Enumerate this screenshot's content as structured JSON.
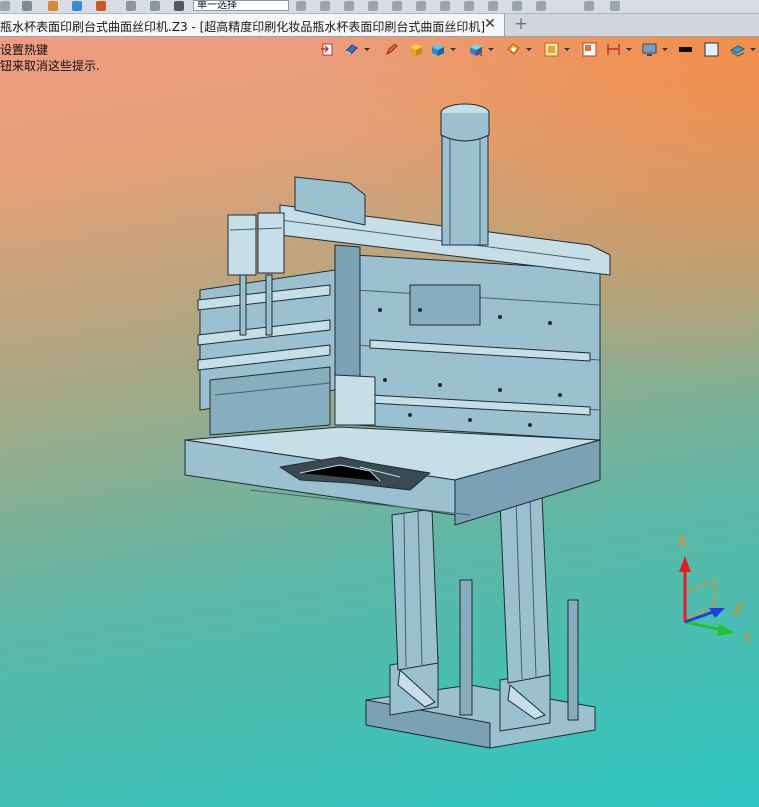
{
  "toolbar": {
    "selection_filter": "单一选择"
  },
  "document_tab": {
    "title": "瓶水杯表面印刷台式曲面丝印机.Z3 - [超高精度印刷化妆品瓶水杯表面印刷台式曲面丝印机]",
    "close_label": "✕",
    "add_label": "+"
  },
  "hints": {
    "line1": "设置热键",
    "line2": "钮来取消这些提示."
  },
  "view_toolbar": {
    "icons": [
      "exit-view-icon",
      "render-mode-icon",
      "pencil-icon",
      "shaded-box-icon",
      "solid-box-icon",
      "view-box-icon",
      "section-icon",
      "fit-view-icon",
      "frame-icon",
      "dimension-icon",
      "display-icon",
      "color-black-icon",
      "color-white-icon",
      "layer-icon"
    ]
  },
  "triad": {
    "x_label": "X",
    "y_label": "Y",
    "z_label": "Z",
    "colors": {
      "x": "#e02020",
      "y": "#22c234",
      "z": "#2040e0",
      "label": "#f08a1c"
    }
  },
  "colors": {
    "model_fill": "#9bc0d0",
    "model_dark": "#6f95a6",
    "model_light": "#c6dee8",
    "model_edge": "#1e2c33"
  }
}
